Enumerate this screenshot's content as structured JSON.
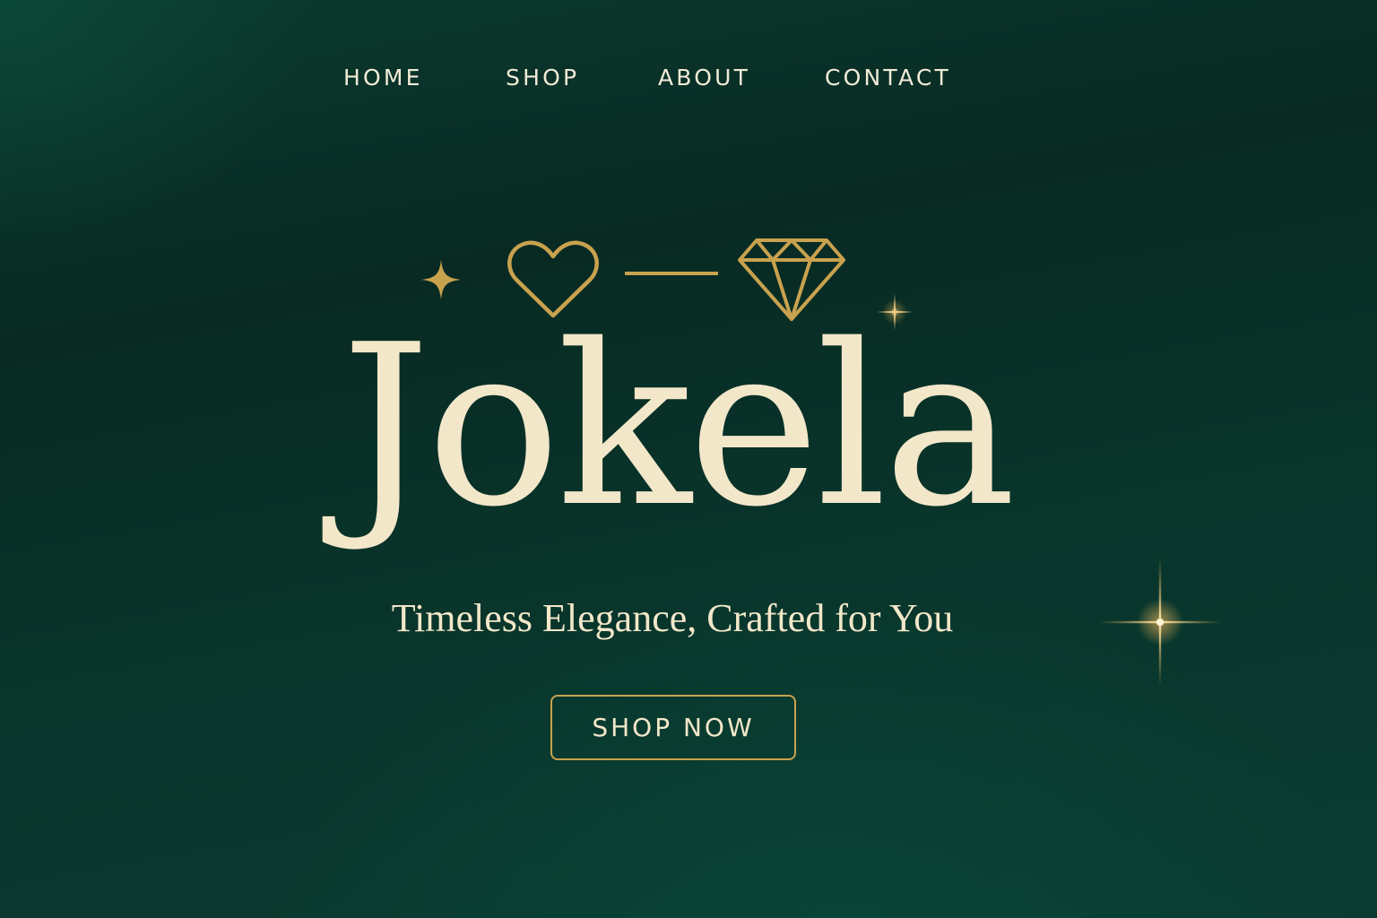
{
  "nav": {
    "items": [
      {
        "label": "HOME"
      },
      {
        "label": "SHOP"
      },
      {
        "label": "ABOUT"
      },
      {
        "label": "CONTACT"
      }
    ]
  },
  "hero": {
    "brand": "Jokela",
    "tagline": "Timeless Elegance, Crafted for You",
    "cta_label": "SHOP NOW",
    "ornament_icons": [
      "sparkle-icon",
      "heart-icon",
      "line-divider",
      "diamond-icon"
    ]
  },
  "colors": {
    "background": "#0a3329",
    "accent_gold": "#c9a24e",
    "text_cream": "#f2e7c9"
  }
}
